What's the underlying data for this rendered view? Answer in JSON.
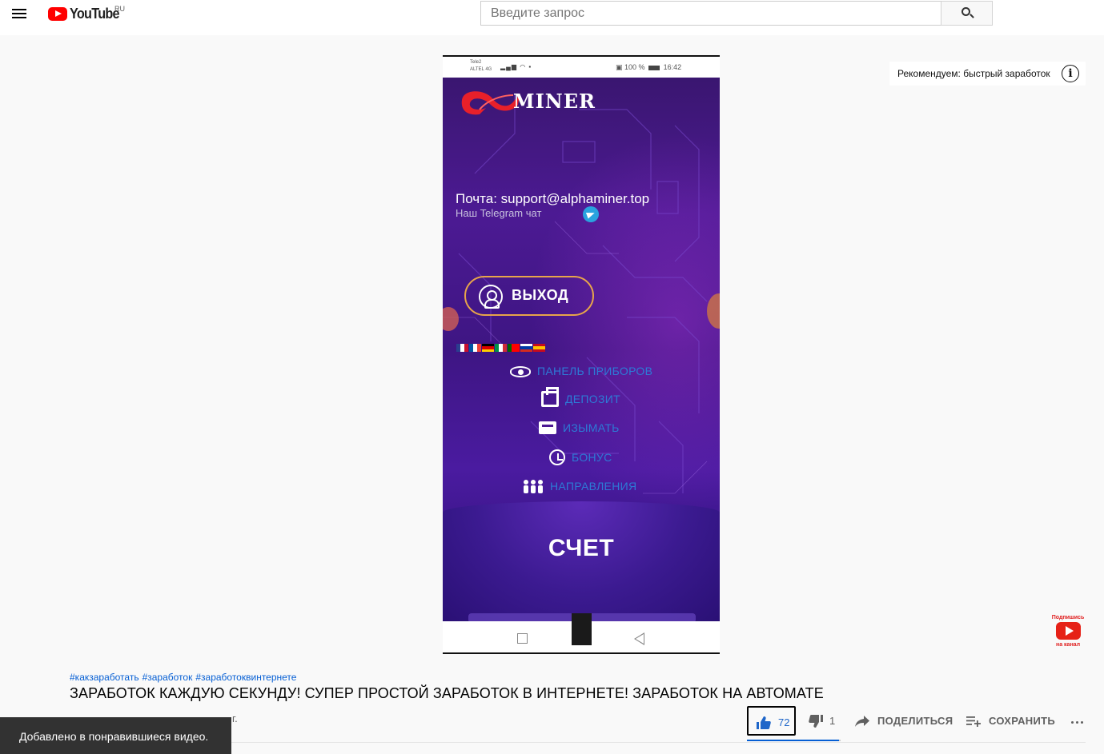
{
  "masthead": {
    "logo_text": "YouTube",
    "country_code": "RU",
    "search_placeholder": "Введите запрос"
  },
  "video": {
    "status_bar": {
      "carrier_1": "Tele2",
      "carrier_2": "ALTEL 4G",
      "battery": "100 %",
      "time": "16:42"
    },
    "app": {
      "brand": "MINER",
      "mail": "Почта: support@alphaminer.top",
      "telegram": "Наш Telegram чат",
      "exit_button": "ВЫХОД",
      "menu": [
        {
          "label": "ПАНЕЛЬ ПРИБОРОВ",
          "icon": "eye-icon"
        },
        {
          "label": "ДЕПОЗИТ",
          "icon": "deposit-icon"
        },
        {
          "label": "ИЗЫМАТЬ",
          "icon": "atm-icon"
        },
        {
          "label": "БОНУС",
          "icon": "clock-icon"
        },
        {
          "label": "НАПРАВЛЕНИЯ",
          "icon": "people-icon"
        }
      ],
      "account_heading": "СЧЕТ",
      "flags": [
        "uk",
        "fr",
        "de",
        "it",
        "pt",
        "ru",
        "es"
      ]
    },
    "recommend_card": "Рекомендуем: быстрый заработок",
    "watermark_top": "Подпишись",
    "watermark_bottom": "на канал"
  },
  "info": {
    "hashtags": [
      "#какзаработать",
      "#заработок",
      "#заработоквинтернете"
    ],
    "title": "ЗАРАБОТОК КАЖДУЮ СЕКУНДУ! СУПЕР ПРОСТОЙ ЗАРАБОТОК В ИНТЕРНЕТЕ! ЗАРАБОТОК НА АВТОМАТЕ",
    "meta_suffix": "г.",
    "like_count": "72",
    "dislike_count": "1",
    "share_label": "ПОДЕЛИТЬСЯ",
    "save_label": "СОХРАНИТЬ",
    "like_ratio": 0.986
  },
  "toast": {
    "message": "Добавлено в понравившиеся видео."
  },
  "colors": {
    "brand_red": "#ff0000",
    "link_blue": "#065fd4",
    "app_purple": "#4c1a93",
    "exit_border": "#e8a54a"
  }
}
